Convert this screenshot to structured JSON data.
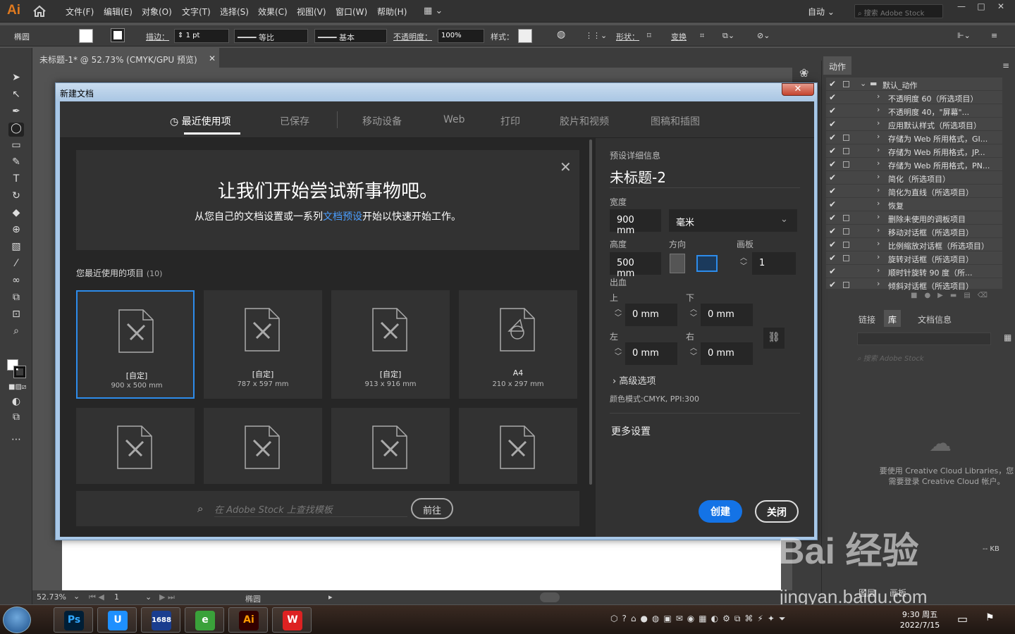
{
  "app": {
    "logo": "Ai"
  },
  "menu": [
    "文件(F)",
    "编辑(E)",
    "对象(O)",
    "文字(T)",
    "选择(S)",
    "效果(C)",
    "视图(V)",
    "窗口(W)",
    "帮助(H)"
  ],
  "header": {
    "workspace": "自动",
    "stock_placeholder": "搜索 Adobe Stock"
  },
  "controlbar": {
    "shape": "椭圆",
    "stroke_label": "描边：",
    "stroke_value": "1 pt",
    "ratio": "等比",
    "basic": "基本",
    "opacity_label": "不透明度：",
    "opacity_value": "100%",
    "style_label": "样式：",
    "shape_label": "形状：",
    "transform_label": "变换"
  },
  "document": {
    "tab_title": "未标题-1* @ 52.73% (CMYK/GPU 预览)",
    "zoom": "52.73%",
    "page": "1",
    "status_tool": "椭圆"
  },
  "dialog": {
    "title": "新建文档",
    "tabs": [
      "最近使用项",
      "已保存",
      "移动设备",
      "Web",
      "打印",
      "胶片和视频",
      "图稿和插图"
    ],
    "hero_title": "让我们开始尝试新事物吧。",
    "hero_sub_prefix": "从您自己的文档设置或一系列",
    "hero_sub_link": "文档预设",
    "hero_sub_suffix": "开始以快速开始工作。",
    "recent_label": "您最近使用的项目",
    "recent_count": "(10)",
    "cards": [
      {
        "name": "[自定]",
        "size": "900 x 500 mm"
      },
      {
        "name": "[自定]",
        "size": "787 x 597 mm"
      },
      {
        "name": "[自定]",
        "size": "913 x 916 mm"
      },
      {
        "name": "A4",
        "size": "210 x 297 mm"
      }
    ],
    "stock_placeholder": "在 Adobe Stock 上查找模板",
    "goto_label": "前往",
    "preset": {
      "section_label": "预设详细信息",
      "name": "未标题-2",
      "width_label": "宽度",
      "width_value": "900 mm",
      "unit": "毫米",
      "height_label": "高度",
      "height_value": "500 mm",
      "orientation_label": "方向",
      "artboard_label": "画板",
      "artboard_value": "1",
      "bleed_label": "出血",
      "top_label": "上",
      "top_value": "0 mm",
      "bottom_label": "下",
      "bottom_value": "0 mm",
      "left_label": "左",
      "left_value": "0 mm",
      "right_label": "右",
      "right_value": "0 mm",
      "advanced_label": "高级选项",
      "color_mode": "颜色模式:CMYK, PPI:300",
      "more_settings": "更多设置"
    },
    "create_label": "创建",
    "close_label": "关闭"
  },
  "actions": {
    "tab": "动作",
    "set_name": "默认_动作",
    "items": [
      {
        "label": "不透明度 60（所选项目）",
        "box": false
      },
      {
        "label": "不透明度 40，\"屏幕\"...",
        "box": false
      },
      {
        "label": "应用默认样式（所选项目）",
        "box": false
      },
      {
        "label": "存储为 Web 所用格式，GI...",
        "box": true
      },
      {
        "label": "存储为 Web 所用格式，JP...",
        "box": true
      },
      {
        "label": "存储为 Web 所用格式，PN...",
        "box": true
      },
      {
        "label": "简化（所选项目）",
        "box": false
      },
      {
        "label": "简化为直线（所选项目）",
        "box": false
      },
      {
        "label": "恢复",
        "box": false
      },
      {
        "label": "删除未使用的调板项目",
        "box": true
      },
      {
        "label": "移动对话框（所选项目）",
        "box": true
      },
      {
        "label": "比例缩放对话框（所选项目）",
        "box": true
      },
      {
        "label": "旋转对话框（所选项目）",
        "box": true
      },
      {
        "label": "顺时针旋转 90 度（所...",
        "box": false
      },
      {
        "label": "倾斜对话框（所选项目）",
        "box": true
      }
    ]
  },
  "library": {
    "tabs": [
      "链接",
      "库",
      "文档信息"
    ],
    "search_placeholder": "搜索 Adobe Stock",
    "message_line1": "要使用 Creative Cloud Libraries，您",
    "message_line2": "需要登录 Creative Cloud 帐户。",
    "kb": "-- KB",
    "bottom_tabs": [
      "图层",
      "画板"
    ]
  },
  "taskbar": {
    "apps": [
      {
        "label": "Ps",
        "color": "#31a8ff",
        "bg": "#001e36"
      },
      {
        "label": "U",
        "color": "#fff",
        "bg": "#1e90ff"
      },
      {
        "label": "1688",
        "color": "#fff",
        "bg": "#1a3d8f"
      },
      {
        "label": "e",
        "color": "#fff",
        "bg": "#3aa13a"
      },
      {
        "label": "Ai",
        "color": "#ff9a00",
        "bg": "#330000"
      },
      {
        "label": "W",
        "color": "#fff",
        "bg": "#d22"
      }
    ],
    "time": "9:30 周五",
    "date": "2022/7/15"
  },
  "watermark": {
    "line1": "Bai 经验",
    "line2": "jingyan.baidu.com"
  }
}
